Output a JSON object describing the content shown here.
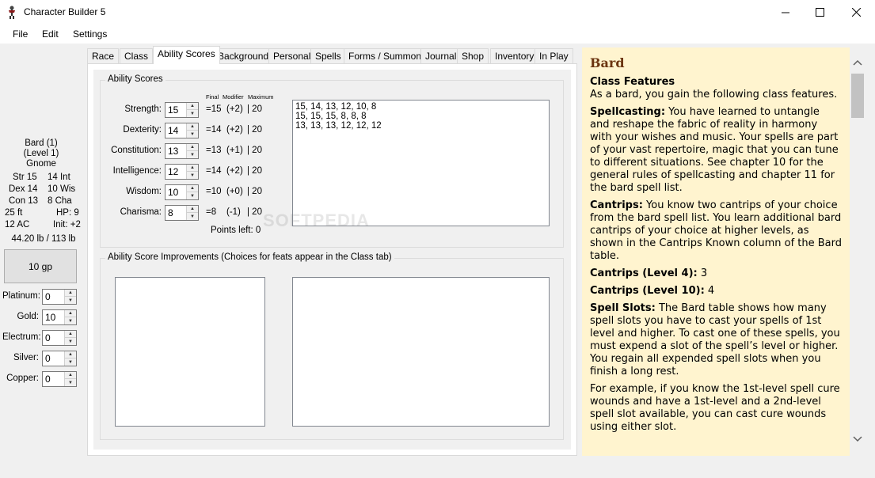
{
  "window": {
    "title": "Character Builder 5"
  },
  "menu": [
    "File",
    "Edit",
    "Settings"
  ],
  "summary": {
    "class_line": "Bard (1)",
    "level_line": "(Level 1)",
    "race": "Gnome",
    "str": "Str 15",
    "int": "14 Int",
    "dex": "Dex 14",
    "wis": "10 Wis",
    "con": "Con 13",
    "cha": "8 Cha",
    "speed": "25 ft",
    "hp": "HP: 9",
    "ac": "12 AC",
    "init": "Init: +2",
    "weight": "44.20 lb / 113 lb"
  },
  "money": {
    "total": "10 gp",
    "coins": [
      {
        "label": "Platinum:",
        "value": "0"
      },
      {
        "label": "Gold:",
        "value": "10"
      },
      {
        "label": "Electrum:",
        "value": "0"
      },
      {
        "label": "Silver:",
        "value": "0"
      },
      {
        "label": "Copper:",
        "value": "0"
      }
    ]
  },
  "tabs": [
    "Race",
    "Class",
    "Ability Scores",
    "Background",
    "Personal",
    "Spells",
    "Forms / Summons",
    "Journal",
    "Shop",
    "Inventory",
    "In Play"
  ],
  "active_tab": "Ability Scores",
  "ability_scores": {
    "group_title": "Ability Scores",
    "col_final": "Final",
    "col_modifier": "Modifier",
    "col_maximum": "Maximum",
    "rows": [
      {
        "name": "Strength:",
        "value": "15",
        "final": "=15",
        "mod": "(+2)",
        "max": "| 20"
      },
      {
        "name": "Dexterity:",
        "value": "14",
        "final": "=14",
        "mod": "(+2)",
        "max": "| 20"
      },
      {
        "name": "Constitution:",
        "value": "13",
        "final": "=13",
        "mod": "(+1)",
        "max": "| 20"
      },
      {
        "name": "Intelligence:",
        "value": "12",
        "final": "=14",
        "mod": "(+2)",
        "max": "| 20"
      },
      {
        "name": "Wisdom:",
        "value": "10",
        "final": "=10",
        "mod": "(+0)",
        "max": "| 20"
      },
      {
        "name": "Charisma:",
        "value": "8",
        "final": "=8",
        "mod": "(-1)",
        "max": "| 20"
      }
    ],
    "points_left": "Points left: 0",
    "arrays": [
      "15, 14, 13, 12, 10, 8",
      "15, 15, 15, 8, 8, 8",
      "13, 13, 13, 12, 12, 12"
    ]
  },
  "improvements": {
    "group_title": "Ability Score Improvements (Choices for feats appear in the Class tab)"
  },
  "watermark": "SOFTPEDIA",
  "details": {
    "title": "Bard",
    "class_features_heading": "Class Features",
    "class_features_text": "As a bard, you gain the following class features.",
    "spellcasting_heading": "Spellcasting:",
    "spellcasting_text": " You have learned to untangle and reshape the fabric of reality in harmony with your wishes and music. Your spells are part of your vast repertoire, magic that you can tune to different situations. See chapter 10 for the general rules of spellcasting and chapter 11 for the bard spell list.",
    "cantrips_heading": "Cantrips:",
    "cantrips_text": " You know two cantrips of your choice from the bard spell list. You learn additional bard cantrips of your choice at higher levels, as shown in the Cantrips Known column of the Bard table.",
    "cantrips4_heading": "Cantrips (Level 4):",
    "cantrips4_text": " 3",
    "cantrips10_heading": "Cantrips (Level 10):",
    "cantrips10_text": " 4",
    "slots_heading": "Spell Slots:",
    "slots_text": " The Bard table shows how many spell slots you have to cast your spells of 1st level and higher. To cast one of these spells, you must expend a slot of the spell’s level or higher. You regain all expended spell slots when you finish a long rest.",
    "example_text": "For example, if you know the 1st-level spell cure wounds and have a 1st-level and a 2nd-level spell slot available, you can cast cure wounds using either slot."
  }
}
